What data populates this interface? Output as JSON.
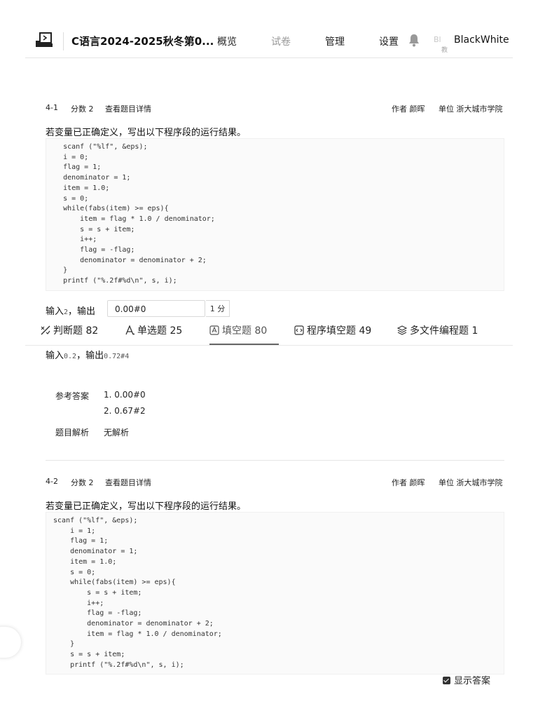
{
  "header": {
    "course_title": "C语言2024-2025秋冬第0...",
    "nav": {
      "overview": "概览",
      "exam": "试卷",
      "manage": "管理",
      "settings": "设置"
    },
    "user_mini": "Bl",
    "user_mini_sub": "教",
    "username": "BlackWhite"
  },
  "tabs": [
    {
      "label": "判断题",
      "count": "82",
      "icon": "scale-icon"
    },
    {
      "label": "单选题",
      "count": "25",
      "icon": "letter-a-icon"
    },
    {
      "label": "填空题",
      "count": "80",
      "icon": "fill-blank-icon",
      "active": true
    },
    {
      "label": "程序填空题",
      "count": "49",
      "icon": "code-fill-icon"
    },
    {
      "label": "多文件编程题",
      "count": "1",
      "icon": "layers-icon"
    }
  ],
  "q1": {
    "number": "4-1",
    "score": "分数 2",
    "details_link": "查看题目详情",
    "author": "作者 颜晖",
    "unit": "单位 浙大城市学院",
    "prompt": "若变量已正确定义，写出以下程序段的运行结果。",
    "code": "    scanf (\"%lf\", &eps);\n    i = 0;\n    flag = 1;\n    denominator = 1;\n    item = 1.0;\n    s = 0;\n    while(fabs(item) >= eps){\n        item = flag * 1.0 / denominator;\n        s = s + item;\n        i++;\n        flag = -flag;\n        denominator = denominator + 2;\n    }\n    printf (\"%.2f#%d\\n\", s, i);",
    "input1_label": "输入",
    "input1_value": "2",
    "output_label": "，输出",
    "answer1": "0.00#0",
    "score_tag": "1 分",
    "input2_label": "输入",
    "input2_value": "0.2",
    "output2_label": "，输出",
    "output2_value": "0.72#4",
    "ref_label": "参考答案",
    "ref_answers": [
      "1.  0.00#0",
      "2.  0.67#2"
    ],
    "analysis_label": "题目解析",
    "analysis_value": "无解析"
  },
  "q2": {
    "number": "4-2",
    "score": "分数 2",
    "details_link": "查看题目详情",
    "author": "作者 颜晖",
    "unit": "单位 浙大城市学院",
    "prompt": "若变量已正确定义，写出以下程序段的运行结果。",
    "code": "scanf (\"%lf\", &eps);\n    i = 1;\n    flag = 1;\n    denominator = 1;\n    item = 1.0;\n    s = 0;\n    while(fabs(item) >= eps){\n        s = s + item;\n        i++;\n        flag = -flag;\n        denominator = denominator + 2;\n        item = flag * 1.0 / denominator;\n    }\n    s = s + item;\n    printf (\"%.2f#%d\\n\", s, i);"
  },
  "show_answer_label": "显示答案"
}
